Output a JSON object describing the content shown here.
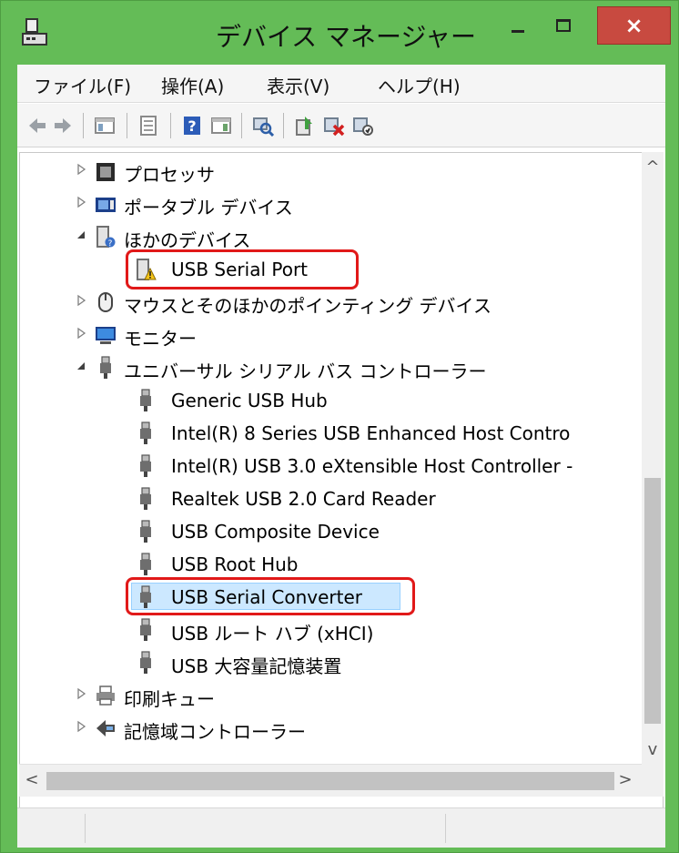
{
  "window": {
    "title": "デバイス マネージャー",
    "close_label": "×"
  },
  "menu": [
    "ファイル(F)",
    "操作(A)",
    "表示(V)",
    "ヘルプ(H)"
  ],
  "toolbar": {
    "icons": [
      "back-icon",
      "forward-icon",
      "show-hide-console-tree-icon",
      "properties-icon",
      "help-icon",
      "action-pane-icon",
      "scan-hardware-icon",
      "update-driver-icon",
      "uninstall-device-icon",
      "disable-device-icon"
    ]
  },
  "tree": {
    "rows": [
      {
        "label": "プロセッサ",
        "icon": "processor-icon",
        "expanded": false
      },
      {
        "label": "ポータブル デバイス",
        "icon": "portable-device-icon",
        "expanded": false
      },
      {
        "label": "ほかのデバイス",
        "icon": "unknown-device-icon",
        "expanded": true
      },
      {
        "label": "USB Serial Port",
        "icon": "warning-device-icon",
        "child": true
      },
      {
        "label": "マウスとそのほかのポインティング デバイス",
        "icon": "mouse-icon",
        "expanded": false
      },
      {
        "label": "モニター",
        "icon": "monitor-icon",
        "expanded": false
      },
      {
        "label": "ユニバーサル シリアル バス コントローラー",
        "icon": "usb-plug-icon",
        "expanded": true
      },
      {
        "label": "Generic USB Hub",
        "icon": "usb-plug-icon",
        "child": true
      },
      {
        "label": "Intel(R) 8 Series USB Enhanced Host Contro",
        "icon": "usb-plug-icon",
        "child": true
      },
      {
        "label": "Intel(R) USB 3.0 eXtensible Host Controller -",
        "icon": "usb-plug-icon",
        "child": true
      },
      {
        "label": "Realtek USB 2.0 Card Reader",
        "icon": "usb-plug-icon",
        "child": true
      },
      {
        "label": "USB Composite Device",
        "icon": "usb-plug-icon",
        "child": true
      },
      {
        "label": "USB Root Hub",
        "icon": "usb-plug-icon",
        "child": true
      },
      {
        "label": "USB Serial Converter",
        "icon": "usb-plug-icon",
        "child": true,
        "selected": true
      },
      {
        "label": "USB ルート ハブ (xHCI)",
        "icon": "usb-plug-icon",
        "child": true
      },
      {
        "label": "USB 大容量記憶装置",
        "icon": "usb-plug-icon",
        "child": true
      },
      {
        "label": "印刷キュー",
        "icon": "printer-icon",
        "expanded": false
      },
      {
        "label": "記憶域コントローラー",
        "icon": "storage-controller-icon",
        "expanded": false
      }
    ]
  },
  "scroll": {
    "up": "^",
    "down": "v",
    "left": "<",
    "right": ">"
  },
  "colors": {
    "frame": "#64bc57",
    "close": "#c84a40",
    "highlight": "#e11919",
    "selected": "#cce8ff"
  }
}
